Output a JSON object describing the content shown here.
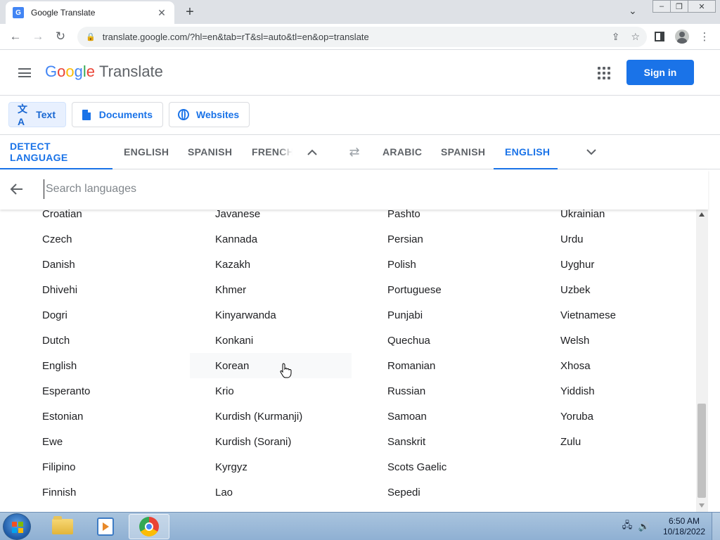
{
  "browser": {
    "tab_title": "Google Translate",
    "favicon_letter": "G",
    "url": "translate.google.com/?hl=en&tab=rT&sl=auto&tl=en&op=translate"
  },
  "header": {
    "logo_letters": [
      "G",
      "o",
      "o",
      "g",
      "l",
      "e"
    ],
    "product": "Translate",
    "signin_label": "Sign in"
  },
  "modes": [
    {
      "label": "Text"
    },
    {
      "label": "Documents"
    },
    {
      "label": "Websites"
    }
  ],
  "source_langs": [
    "DETECT LANGUAGE",
    "ENGLISH",
    "SPANISH",
    "FRENCH"
  ],
  "target_langs": [
    "ARABIC",
    "SPANISH",
    "ENGLISH"
  ],
  "search": {
    "placeholder": "Search languages"
  },
  "languages": {
    "col1": [
      "Croatian",
      "Czech",
      "Danish",
      "Dhivehi",
      "Dogri",
      "Dutch",
      "English",
      "Esperanto",
      "Estonian",
      "Ewe",
      "Filipino",
      "Finnish"
    ],
    "col2": [
      "Javanese",
      "Kannada",
      "Kazakh",
      "Khmer",
      "Kinyarwanda",
      "Konkani",
      "Korean",
      "Krio",
      "Kurdish (Kurmanji)",
      "Kurdish (Sorani)",
      "Kyrgyz",
      "Lao"
    ],
    "col3": [
      "Pashto",
      "Persian",
      "Polish",
      "Portuguese",
      "Punjabi",
      "Quechua",
      "Romanian",
      "Russian",
      "Samoan",
      "Sanskrit",
      "Scots Gaelic",
      "Sepedi"
    ],
    "col4": [
      "Ukrainian",
      "Urdu",
      "Uyghur",
      "Uzbek",
      "Vietnamese",
      "Welsh",
      "Xhosa",
      "Yiddish",
      "Yoruba",
      "Zulu"
    ]
  },
  "taskbar": {
    "time": "6:50 AM",
    "date": "10/18/2022"
  }
}
